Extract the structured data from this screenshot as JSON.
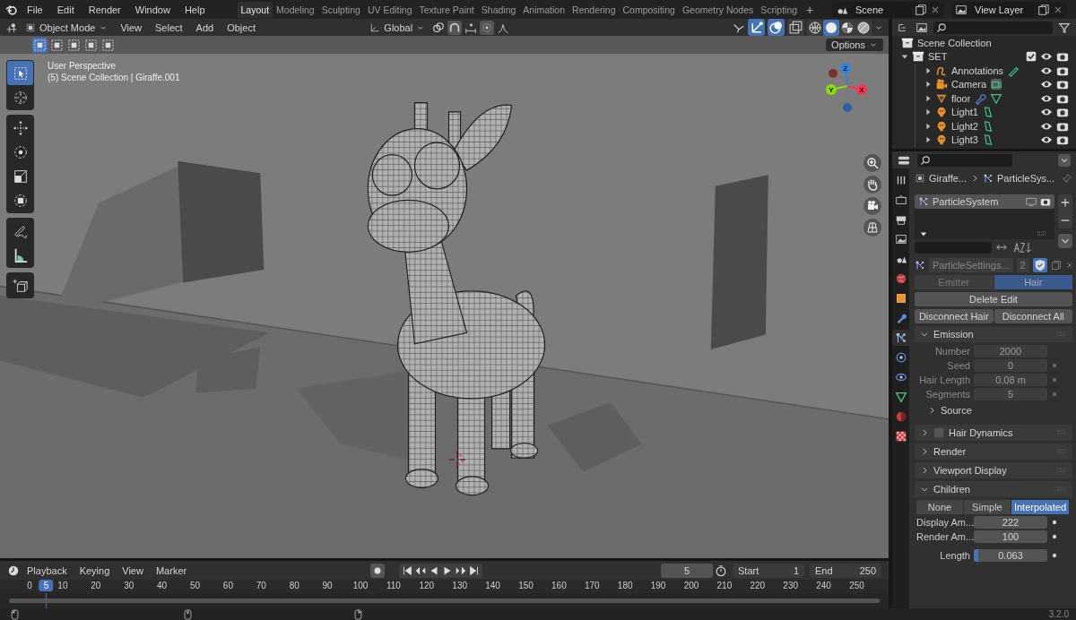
{
  "topbar": {
    "menus": [
      "File",
      "Edit",
      "Render",
      "Window",
      "Help"
    ],
    "workspaces": [
      {
        "label": "Layout",
        "selected": true
      },
      {
        "label": "Modeling",
        "selected": false
      },
      {
        "label": "Sculpting",
        "selected": false
      },
      {
        "label": "UV Editing",
        "selected": false
      },
      {
        "label": "Texture Paint",
        "selected": false
      },
      {
        "label": "Shading",
        "selected": false
      },
      {
        "label": "Animation",
        "selected": false
      },
      {
        "label": "Rendering",
        "selected": false
      },
      {
        "label": "Compositing",
        "selected": false
      },
      {
        "label": "Geometry Nodes",
        "selected": false
      },
      {
        "label": "Scripting",
        "selected": false
      }
    ],
    "add_label": "+",
    "scene": "Scene",
    "view_layer": "View Layer"
  },
  "viewport": {
    "mode": "Object Mode",
    "menus": [
      "View",
      "Select",
      "Add",
      "Object"
    ],
    "orientation": "Global",
    "header_toggles": [
      {
        "kind": "gizmo",
        "on": true
      },
      {
        "kind": "overlay",
        "on": true
      },
      {
        "kind": "xray",
        "on": false
      }
    ],
    "shading": [
      {
        "kind": "wireframe",
        "selected": false
      },
      {
        "kind": "solid",
        "selected": true
      },
      {
        "kind": "material",
        "selected": false
      },
      {
        "kind": "rendered",
        "selected": false
      }
    ],
    "select_modes": [
      {
        "selected": true
      },
      {
        "selected": false
      },
      {
        "selected": false
      },
      {
        "selected": false
      },
      {
        "selected": false
      }
    ],
    "options": "Options",
    "view_name": "User Perspective",
    "context": "(5) Scene Collection | Giraffe.001",
    "tool_groups": [
      [
        {
          "kind": "select",
          "selected": true
        },
        {
          "kind": "cursor",
          "selected": false
        }
      ],
      [
        {
          "kind": "move",
          "selected": false
        },
        {
          "kind": "rotate",
          "selected": false
        },
        {
          "kind": "scale",
          "selected": false
        },
        {
          "kind": "transform",
          "selected": false
        }
      ],
      [
        {
          "kind": "annotate",
          "selected": false
        },
        {
          "kind": "measure",
          "selected": false
        }
      ],
      [
        {
          "kind": "add_cube",
          "selected": false
        }
      ]
    ],
    "axes": [
      {
        "label": "Z",
        "color": "#2f83e3"
      },
      {
        "label": "Y",
        "color": "#8bdc00"
      },
      {
        "label": "X",
        "color": "#ff3352"
      }
    ]
  },
  "timeline": {
    "menus": [
      "Playback",
      "Keying",
      "View",
      "Marker"
    ],
    "current_frame": "5",
    "frame_marker": "5",
    "start_label": "Start",
    "start": "1",
    "end_label": "End",
    "end": "250",
    "ruler": [
      "0",
      "10",
      "20",
      "30",
      "40",
      "50",
      "60",
      "70",
      "80",
      "90",
      "100",
      "110",
      "120",
      "130",
      "140",
      "150",
      "160",
      "170",
      "180",
      "190",
      "200",
      "210",
      "220",
      "230",
      "240",
      "250"
    ]
  },
  "outliner": {
    "root": "Scene Collection",
    "items": [
      {
        "name": "SET",
        "kind": "collection",
        "expanded": true,
        "checked": true,
        "children": [
          {
            "name": "Annotations",
            "kind": "annotation",
            "expanded": false
          },
          {
            "name": "Camera",
            "kind": "camera",
            "expanded": false
          },
          {
            "name": "floor",
            "kind": "mesh",
            "expanded": false
          },
          {
            "name": "Light1",
            "kind": "light",
            "expanded": false
          },
          {
            "name": "Light2",
            "kind": "light",
            "expanded": false
          },
          {
            "name": "Light3",
            "kind": "light",
            "expanded": false
          }
        ]
      }
    ]
  },
  "properties": {
    "tabs": [
      {
        "kind": "tool",
        "selected": false
      },
      {
        "kind": "render",
        "selected": false
      },
      {
        "kind": "output",
        "selected": false
      },
      {
        "kind": "view_layer",
        "selected": false
      },
      {
        "kind": "scene",
        "selected": false
      },
      {
        "kind": "world",
        "selected": false
      },
      {
        "kind": "object",
        "selected": false
      },
      {
        "kind": "modifiers",
        "selected": false
      },
      {
        "kind": "particles",
        "selected": true
      },
      {
        "kind": "physics",
        "selected": false
      },
      {
        "kind": "constraints",
        "selected": false
      },
      {
        "kind": "data",
        "selected": false
      },
      {
        "kind": "material",
        "selected": false
      },
      {
        "kind": "texture",
        "selected": false
      }
    ],
    "breadcrumb": [
      "Giraffe...",
      "ParticleSys..."
    ],
    "systems": [
      {
        "name": "ParticleSystem",
        "selected": true
      }
    ],
    "settings": {
      "name": "ParticleSettings...",
      "users": "2"
    },
    "type_toggle": [
      {
        "label": "Emitter",
        "selected": false
      },
      {
        "label": "Hair",
        "selected": true
      }
    ],
    "button_rows": [
      [
        "Delete Edit"
      ],
      [
        "Disconnect Hair",
        "Disconnect All"
      ]
    ],
    "panels": [
      {
        "title": "Emission",
        "expanded": true,
        "fields": [
          {
            "label": "Number",
            "value": "2000",
            "disabled": true,
            "keyframe_dot": false
          },
          {
            "label": "Seed",
            "value": "0",
            "disabled": true,
            "keyframe_dot": true
          },
          {
            "label": "Hair Length",
            "value": "0.08 m",
            "disabled": true,
            "keyframe_dot": true
          },
          {
            "label": "Segments",
            "value": "5",
            "disabled": true,
            "keyframe_dot": true
          }
        ],
        "subpanels": [
          {
            "title": "Source",
            "expanded": false
          }
        ]
      },
      {
        "title": "Hair Dynamics",
        "expanded": false,
        "checked": false
      },
      {
        "title": "Render",
        "expanded": false
      },
      {
        "title": "Viewport Display",
        "expanded": false
      },
      {
        "title": "Children",
        "expanded": true,
        "choices": [
          {
            "label": "None",
            "selected": false
          },
          {
            "label": "Simple",
            "selected": false
          },
          {
            "label": "Interpolated",
            "selected": true
          }
        ],
        "fields": [
          {
            "label": "Display Am...",
            "value": "222",
            "disabled": false,
            "keyframe_dot": true
          },
          {
            "label": "Render Am...",
            "value": "100",
            "disabled": false,
            "keyframe_dot": true
          },
          {
            "label": "Length",
            "value": "0.063",
            "disabled": false,
            "keyframe_dot": true,
            "level": 0.063
          }
        ]
      }
    ]
  },
  "status": {
    "version": "3.2.0"
  }
}
